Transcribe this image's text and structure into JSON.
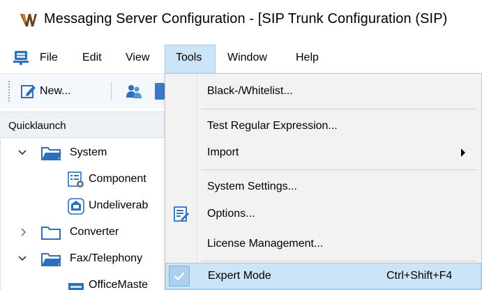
{
  "window": {
    "title": "Messaging Server Configuration - [SIP Trunk Configuration (SIP)",
    "icon": "app-logo-icon"
  },
  "menubar": {
    "icon": "server-icon",
    "items": [
      {
        "label": "File"
      },
      {
        "label": "Edit"
      },
      {
        "label": "View"
      },
      {
        "label": "Tools"
      },
      {
        "label": "Window"
      },
      {
        "label": "Help"
      }
    ],
    "active": "Tools"
  },
  "toolbar": {
    "new_label": "New...",
    "icons": [
      "new-icon",
      "users-icon",
      "book-icon"
    ]
  },
  "quicklaunch": {
    "title": "Quicklaunch",
    "items": [
      {
        "label": "System",
        "expanded": true,
        "icon": "folder-icon"
      },
      {
        "label": "Component",
        "icon": "component-icon"
      },
      {
        "label": "Undeliverab",
        "icon": "undeliverable-icon"
      },
      {
        "label": "Converter",
        "expanded": false,
        "icon": "folder-icon"
      },
      {
        "label": "Fax/Telephony",
        "expanded": true,
        "icon": "folder-icon"
      },
      {
        "label": "OfficeMaste",
        "icon": "officemaster-icon"
      }
    ]
  },
  "tools_menu": {
    "items": [
      {
        "label": "Black-/Whitelist..."
      },
      {
        "label": "Test Regular Expression..."
      },
      {
        "label": "Import",
        "has_submenu": true
      },
      {
        "label": "System Settings..."
      },
      {
        "label": "Options...",
        "icon": "options-icon"
      },
      {
        "label": "License Management..."
      },
      {
        "label": "Expert Mode",
        "shortcut": "Ctrl+Shift+F4",
        "checked": true,
        "highlighted": true
      }
    ]
  },
  "colors": {
    "highlight": "#cce4f7",
    "highlight_border": "#99c9ef",
    "menu_bg": "#f2f2f2",
    "folder_blue": "#2c6fbd",
    "toolbar_bg": "#f4f7fc"
  }
}
